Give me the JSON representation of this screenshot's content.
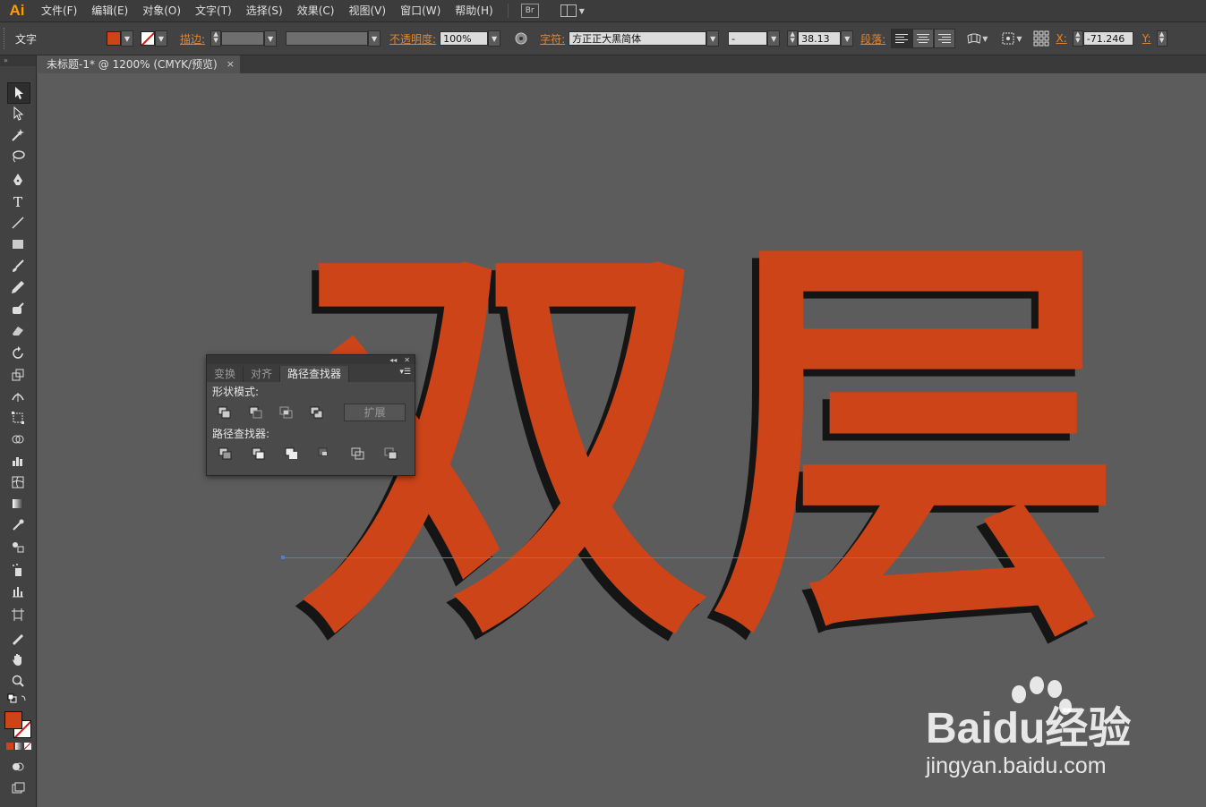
{
  "app": {
    "logo": "Ai"
  },
  "menu": [
    "文件(F)",
    "编辑(E)",
    "对象(O)",
    "文字(T)",
    "选择(S)",
    "效果(C)",
    "视图(V)",
    "窗口(W)",
    "帮助(H)"
  ],
  "bridge_badge": "Br",
  "control": {
    "type_label": "文字",
    "fill_color": "#cc4418",
    "stroke_label": "描边:",
    "opacity_label": "不透明度:",
    "opacity_value": "100%",
    "char_label": "字符:",
    "font_family": "方正正大黑简体",
    "font_style": "-",
    "font_size": "38.13",
    "para_label": "段落:",
    "x_label": "X:",
    "x_value": "-71.246",
    "y_label": "Y:"
  },
  "document_tab": {
    "title": "未标题-1* @ 1200% (CMYK/预览)",
    "close": "×"
  },
  "artwork": {
    "text": "双层",
    "color": "#cc4418",
    "shadow_color": "#151515"
  },
  "pathfinder_panel": {
    "tabs": [
      "变换",
      "对齐",
      "路径查找器"
    ],
    "active_tab": "路径查找器",
    "shape_modes_label": "形状模式:",
    "expand_label": "扩展",
    "pathfinders_label": "路径查找器:"
  },
  "watermark": {
    "brand": "Baidu经验",
    "url": "jingyan.baidu.com"
  }
}
